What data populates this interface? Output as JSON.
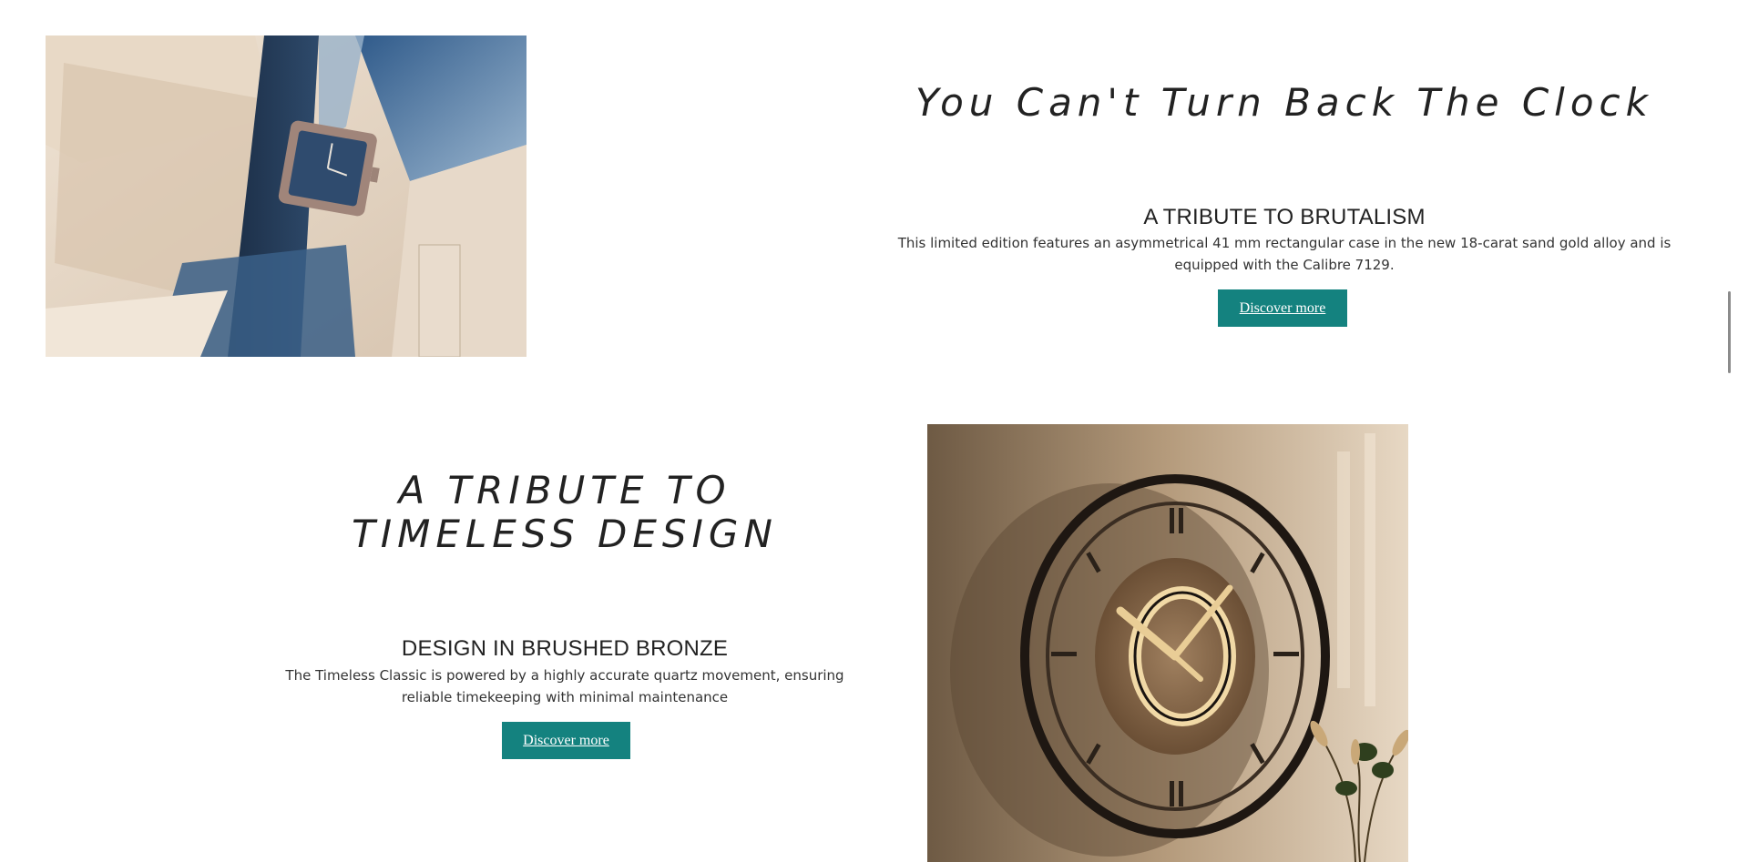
{
  "section1": {
    "image_alt": "Rectangular watch with navy leather strap among geometric glass panels",
    "headline": "You Can't Turn Back The Clock",
    "subheading": "A TRIBUTE TO BRUTALISM",
    "description": "This limited edition features an asymmetrical 41 mm rectangular case in the new 18-carat sand gold alloy and is equipped with the Calibre 7129.",
    "button_label": "Discover more"
  },
  "section2": {
    "headline": "A TRIBUTE TO TIMELESS DESIGN",
    "subheading": "DESIGN IN BRUSHED BRONZE",
    "description": "The Timeless Classic is powered by a highly accurate quartz movement, ensuring reliable timekeeping with minimal maintenance",
    "button_label": "Discover more",
    "image_alt": "Wooden skeleton wall clock with Roman numerals"
  },
  "colors": {
    "button": "#14827f",
    "heading": "#222222"
  }
}
